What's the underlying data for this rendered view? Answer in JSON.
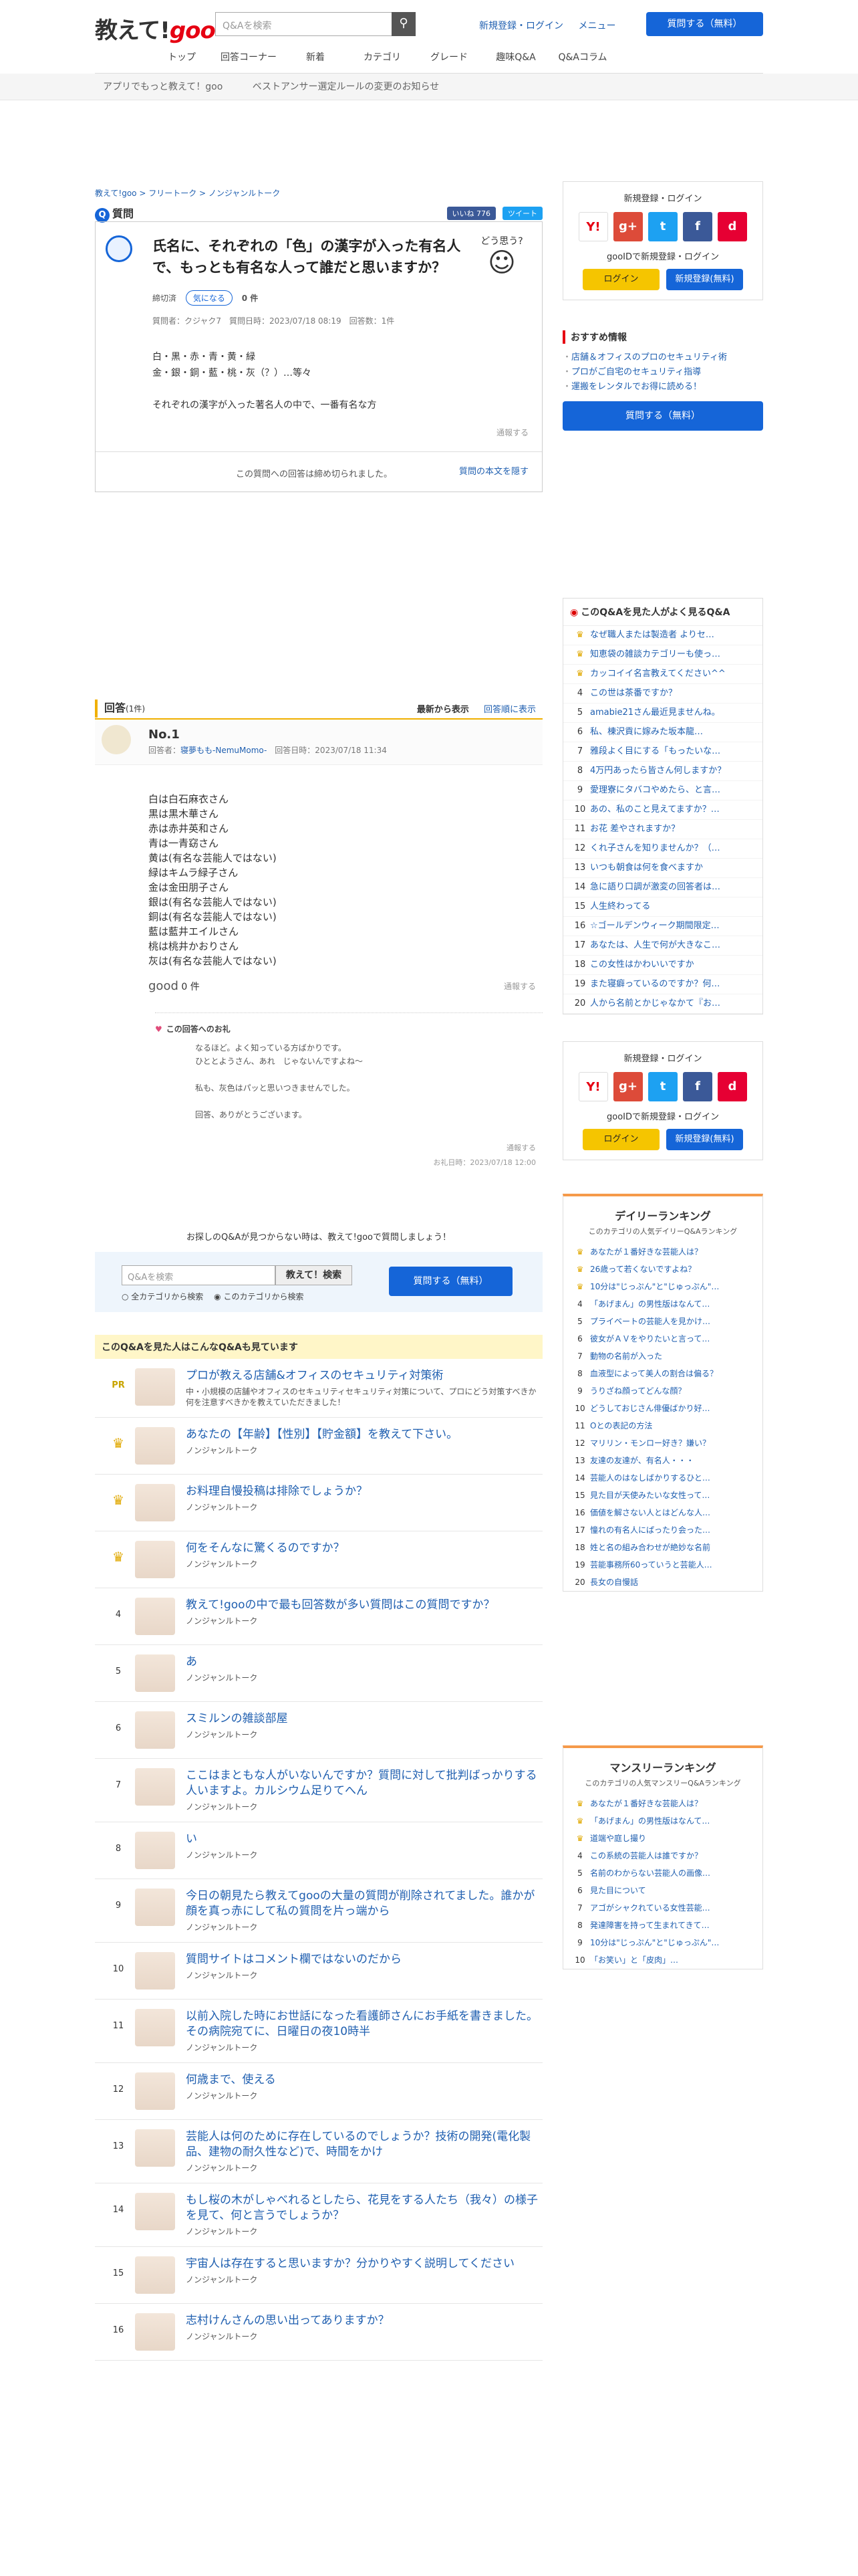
{
  "header": {
    "logo_main": "教えて!",
    "logo_goo": "goo",
    "search_placeholder": "Q&Aを検索",
    "links": [
      "新規登録・ログイン",
      "メニュー"
    ],
    "ask_button": "質問する（無料）",
    "nav": [
      "トップ",
      "回答コーナー",
      "新着",
      "カテゴリ",
      "グレード",
      "趣味Q&A",
      "Q&Aコラム"
    ],
    "subbar": [
      "アプリでもっと教えて！goo",
      "ベストアンサー選定ルールの変更のお知らせ"
    ]
  },
  "breadcrumb": "教えて!goo > フリートーク > ノンジャンルトーク",
  "question": {
    "label": "質問",
    "like_count": "いいね 776",
    "tweet": "ツイート",
    "title": "氏名に、それぞれの「色」の漢字が入った有名人で、もっとも有名な人って誰だと思いますか？",
    "art_text": "どう思う?",
    "deadline": "締切済",
    "curious": "気になる",
    "curious_count": "0 件",
    "meta": "質問者：クジャク7　質問日時：2023/07/18 08:19　回答数：1件",
    "body": [
      "白・黒・赤・青・黄・緑",
      "金・銀・銅・藍・桃・灰（？）…等々",
      "",
      "それぞれの漢字が入った著名人の中で、一番有名な方"
    ],
    "report": "通報する",
    "closed": "この質問への回答は締め切られました。",
    "show_text": "質問の本文を隠す"
  },
  "answers": {
    "heading": "回答",
    "count": "(1件)",
    "sort_active": "最新から表示",
    "sort_other": "回答順に表示",
    "items": [
      {
        "no": "No.1",
        "respondent_label": "回答者：",
        "respondent": "寝夢もも-NemuMomo-",
        "date": "回答日時：2023/07/18 11:34",
        "body": [
          "白は白石麻衣さん",
          "黒は黒木華さん",
          "赤は赤井英和さん",
          "青は一青窈さん",
          "黄は(有名な芸能人ではない)",
          "緑はキムラ緑子さん",
          "金は金田朋子さん",
          "銀は(有名な芸能人ではない)",
          "銅は(有名な芸能人ではない)",
          "藍は藍井エイルさん",
          "桃は桃井かおりさん",
          "灰は(有名な芸能人ではない)"
        ],
        "good": "good",
        "good_count": "0 件",
        "report": "通報する",
        "thanks_heading": "この回答へのお礼",
        "thanks_body": [
          "なるほど。よく知っている方ばかりです。",
          "ひととようさん、あれ　じゃないんですよね～",
          "",
          "私も、灰色はパッと思いつきませんでした。",
          "",
          "回答、ありがとうございます。"
        ],
        "thanks_report": "通報する",
        "thanks_date": "お礼日時：2023/07/18 12:00"
      }
    ]
  },
  "finder": {
    "lead": "お探しのQ&Aが見つからない時は、教えて!gooで質問しましょう！",
    "placeholder": "Q&Aを検索",
    "search_button": "教えて！検索",
    "opt_all": "全カテゴリから検索",
    "opt_cat": "このカテゴリから検索",
    "ask": "質問する（無料）"
  },
  "related": {
    "heading": "このQ&Aを見た人はこんなQ&Aも見ています",
    "items": [
      {
        "rank": "PR",
        "title": "プロが教える店舗&オフィスのセキュリティ対策術",
        "cat": "中・小規模の店舗やオフィスのセキュリティセキュリティ対策について、プロにどう対策すべきか 何を注意すべきかを教えていただきました！"
      },
      {
        "rank": "♛",
        "title": "あなたの【年齢】【性別】【貯金額】を教えて下さい。",
        "cat": "ノンジャンルトーク"
      },
      {
        "rank": "♛",
        "title": "お料理自慢投稿は排除でしょうか？",
        "cat": "ノンジャンルトーク"
      },
      {
        "rank": "♛",
        "title": "何をそんなに驚くるのですか？",
        "cat": "ノンジャンルトーク"
      },
      {
        "rank": "4",
        "title": "教えて!gooの中で最も回答数が多い質問はこの質問ですか？",
        "cat": "ノンジャンルトーク"
      },
      {
        "rank": "5",
        "title": "あ",
        "cat": "ノンジャンルトーク"
      },
      {
        "rank": "6",
        "title": "スミルンの雑談部屋",
        "cat": "ノンジャンルトーク"
      },
      {
        "rank": "7",
        "title": "ここはまともな人がいないんですか？質問に対して批判ばっかりする人いますよ。カルシウム足りてへん",
        "cat": "ノンジャンルトーク"
      },
      {
        "rank": "8",
        "title": "い",
        "cat": "ノンジャンルトーク"
      },
      {
        "rank": "9",
        "title": "今日の朝見たら教えてgooの大量の質問が削除されてました。誰かが顔を真っ赤にして私の質問を片っ端から",
        "cat": "ノンジャンルトーク"
      },
      {
        "rank": "10",
        "title": "質問サイトはコメント欄ではないのだから",
        "cat": "ノンジャンルトーク"
      },
      {
        "rank": "11",
        "title": "以前入院した時にお世話になった看護師さんにお手紙を書きました。その病院宛てに、日曜日の夜10時半",
        "cat": "ノンジャンルトーク"
      },
      {
        "rank": "12",
        "title": "何歳まで、使える",
        "cat": "ノンジャンルトーク"
      },
      {
        "rank": "13",
        "title": "芸能人は何のために存在しているのでしょうか？技術の開発(電化製品、建物の耐久性など)で、時間をかけ",
        "cat": "ノンジャンルトーク"
      },
      {
        "rank": "14",
        "title": "もし桜の木がしゃべれるとしたら、花見をする人たち（我々）の様子を見て、何と言うでしょうか？",
        "cat": "ノンジャンルトーク"
      },
      {
        "rank": "15",
        "title": "宇宙人は存在すると思いますか？分かりやすく説明してください",
        "cat": "ノンジャンルトーク"
      },
      {
        "rank": "16",
        "title": "志村けんさんの思い出ってありますか？",
        "cat": "ノンジャンルトーク"
      }
    ]
  },
  "side": {
    "login_title": "新規登録・ログイン",
    "register_title": "gooIDで新規登録・ログイン",
    "login_btn": "ログイン",
    "register_btn": "新規登録(無料)",
    "sns": [
      "Y!",
      "g+",
      "t",
      "f",
      "d"
    ],
    "rec_heading": "おすすめ情報",
    "rec_items": [
      "店舗＆オフィスのプロのセキュリティ術",
      "プロがご自宅のセキュリティ指導",
      "運搬をレンタルでお得に読める！"
    ],
    "rec_ask": "質問する（無料）",
    "rank_heading": "このQ&Aを見た人がよく見るQ&A",
    "rank_items": [
      "なぜ職人または製造者 よりセ…",
      "知恵袋の雑談カテゴリーも使っ…",
      "カッコイイ名言教えてください^^",
      "この世は茶番ですか？",
      "amabie21さん最近見ませんね。",
      "私、棟沢貢に嫁みた坂本龍…",
      "雅段よく目にする「もったいな…",
      "4万円あったら皆さん何しますか？",
      "愛理寮にタバコやめたら、と言…",
      "あの、私のこと見えてますか？…",
      "お花 差やされますか？",
      "くれ子さんを知りませんか？（…",
      "いつも朝食は何を食べますか",
      "急に語り口調が激変の回答者は…",
      "人生終わってる",
      "☆ゴールデンウィーク期間限定…",
      "あなたは、人生で何が大きなこ…",
      "この女性はかわいいですか",
      "また寝癖っているのですか？何…",
      "人から名前とかじゃなかて『お…"
    ],
    "daily_title": "デイリーランキング",
    "daily_sub": "このカテゴリの人気デイリーQ&Aランキング",
    "daily_items": [
      "あなたが１番好きな芸能人は？",
      "26歳って若くないですよね？",
      "10分は\"じっぷん\"と\"じゅっぷん\"…",
      "「あげまん」の男性版はなんて…",
      "プライベートの芸能人を見かけ…",
      "彼女がＡＶをやりたいと言って…",
      "動物の名前が入った",
      "血液型によって美人の割合は偏る？",
      "うりざね顔ってどんな顔？",
      "どうしておじさん俳優ばかり好…",
      "Oとの表記の方法",
      "マリリン・モンロー好き？嫌い？",
      "友達の友達が、有名人・・・",
      "芸能人のはなしばかりするひと…",
      "見た目が天使みたいな女性って…",
      "価値を解さない人とはどんな人…",
      "憧れの有名人にぱったり会った…",
      "姓と名の組み合わせが絶妙な名前",
      "芸能事務所60っていうと芸能人…",
      "長女の自慢話"
    ],
    "monthly_title": "マンスリーランキング",
    "monthly_sub": "このカテゴリの人気マンスリーQ&Aランキング",
    "monthly_items": [
      "あなたが１番好きな芸能人は？",
      "「あげまん」の男性版はなんて…",
      "道端や庭し撮り",
      "この系統の芸能人は誰ですか？",
      "名前のわからない芸能人の画像…",
      "見た目について",
      "アゴがシャクれている女性芸能…",
      "発達障害を持って生まれてきて…",
      "10分は\"じっぷん\"と\"じゅっぷん\"…",
      "「お笑い」と「皮肉」…"
    ]
  }
}
